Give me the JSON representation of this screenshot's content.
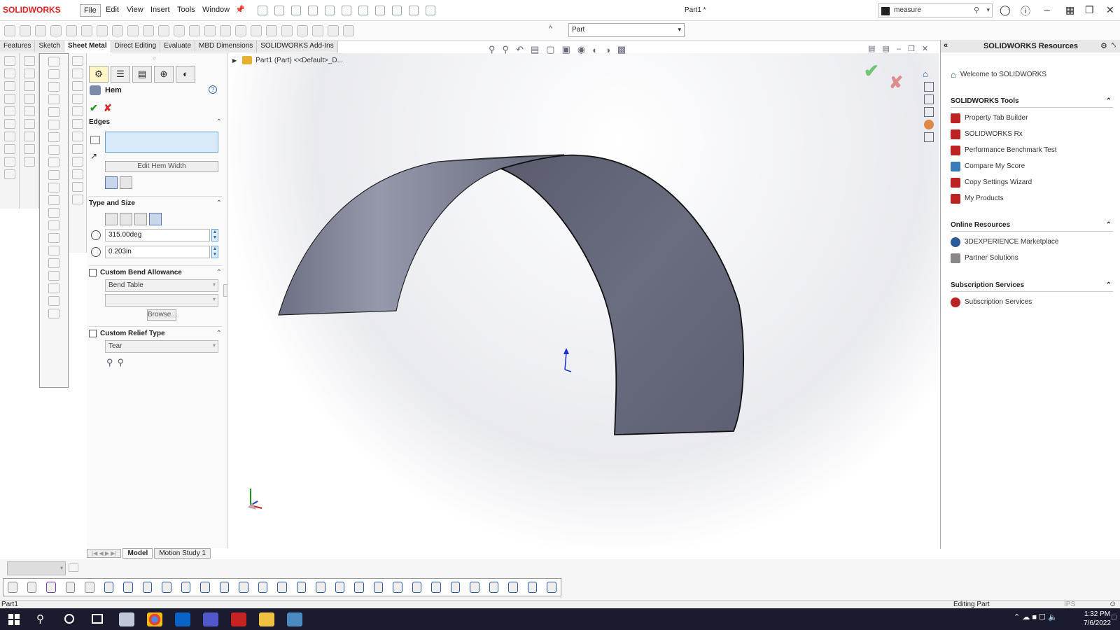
{
  "app": {
    "logo": "SOLIDWORKS",
    "doc_title": "Part1 *"
  },
  "menu": [
    "File",
    "Edit",
    "View",
    "Insert",
    "Tools",
    "Window"
  ],
  "search": {
    "value": "measure"
  },
  "part_selector": {
    "value": "Part"
  },
  "command_tabs": [
    "Features",
    "Sketch",
    "Sheet Metal",
    "Direct Editing",
    "Evaluate",
    "MBD Dimensions",
    "SOLIDWORKS Add-Ins"
  ],
  "active_command_tab": "Sheet Metal",
  "feature_tree": {
    "item": "Part1 (Part) <<Default>_D..."
  },
  "property_manager": {
    "title": "Hem",
    "sections": {
      "edges": {
        "title": "Edges",
        "button": "Edit Hem Width"
      },
      "type_size": {
        "title": "Type and Size",
        "angle": "315.00deg",
        "radius": "0.203in"
      },
      "bend_allowance": {
        "title": "Custom Bend Allowance",
        "type": "Bend Table",
        "browse": "Browse..."
      },
      "relief": {
        "title": "Custom Relief Type",
        "type": "Tear"
      }
    }
  },
  "resources": {
    "title": "SOLIDWORKS Resources",
    "welcome": "Welcome to SOLIDWORKS",
    "tools_title": "SOLIDWORKS Tools",
    "tools": [
      "Property Tab Builder",
      "SOLIDWORKS Rx",
      "Performance Benchmark Test",
      "Compare My Score",
      "Copy Settings Wizard",
      "My Products"
    ],
    "online_title": "Online Resources",
    "online": [
      "3DEXPERIENCE Marketplace",
      "Partner Solutions"
    ],
    "subscription_title": "Subscription Services",
    "subscription": [
      "Subscription Services"
    ]
  },
  "bottom_tabs": [
    "Model",
    "Motion Study 1"
  ],
  "status": {
    "left": "Part1",
    "editing": "Editing Part",
    "units": "IPS"
  },
  "taskbar": {
    "time": "1:32 PM",
    "date": "7/6/2022"
  },
  "colors": {
    "brand": "#d22222",
    "accent_ok": "#2a9a2a",
    "cancel": "#d23030",
    "model": "#6f7185"
  }
}
